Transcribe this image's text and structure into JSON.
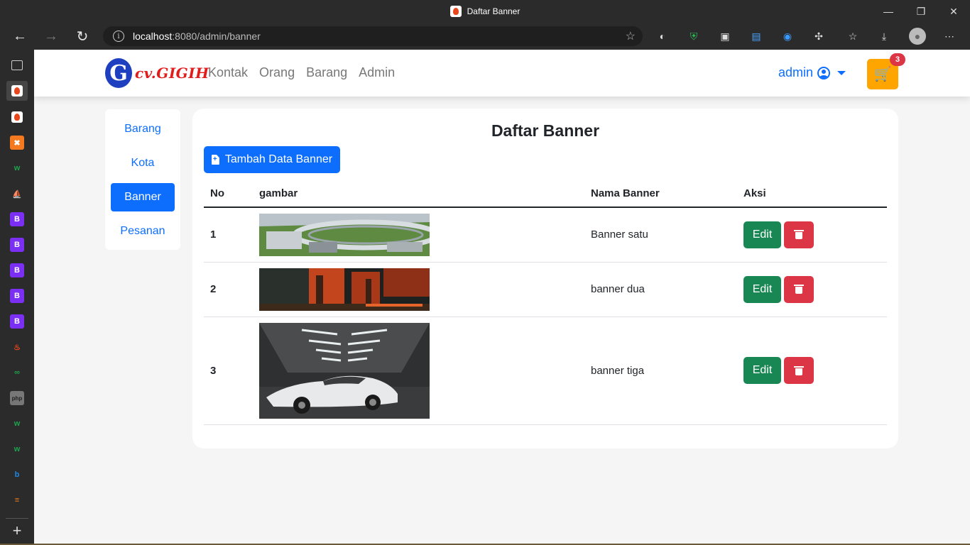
{
  "browser": {
    "window_title": "Daftar Banner",
    "url_host": "localhost",
    "url_rest": ":8080/admin/banner",
    "minimize": "—",
    "restore": "❐",
    "close": "✕",
    "back": "←",
    "forward": "→",
    "reload": "↻",
    "more": "⋯"
  },
  "side_tabs": [
    "B",
    "B",
    "B",
    "B",
    "B"
  ],
  "navbar": {
    "brand_letter": "G",
    "brand_text": "cv.GIGIH",
    "links": [
      "Kontak",
      "Orang",
      "Barang",
      "Admin"
    ],
    "user": "admin",
    "cart_count": "3",
    "cart_icon": "🛒"
  },
  "sidemenu": {
    "items": [
      "Barang",
      "Kota",
      "Banner",
      "Pesanan"
    ],
    "active": "Banner"
  },
  "main": {
    "title": "Daftar Banner",
    "add_button": "Tambah Data Banner",
    "columns": [
      "No",
      "gambar",
      "Nama Banner",
      "Aksi"
    ],
    "rows": [
      {
        "no": "1",
        "name": "Banner satu",
        "image": "futuristic-city-banner-image"
      },
      {
        "no": "2",
        "name": "banner dua",
        "image": "orange-industrial-night-banner-image"
      },
      {
        "no": "3",
        "name": "banner tiga",
        "image": "white-sports-car-banner-image"
      }
    ],
    "edit_label": "Edit"
  },
  "colors": {
    "primary": "#0d6efd",
    "success": "#198754",
    "danger": "#dc3545",
    "cart": "#ffa500",
    "brand_red": "#e21b1b",
    "brand_blue": "#1e3fbf"
  }
}
